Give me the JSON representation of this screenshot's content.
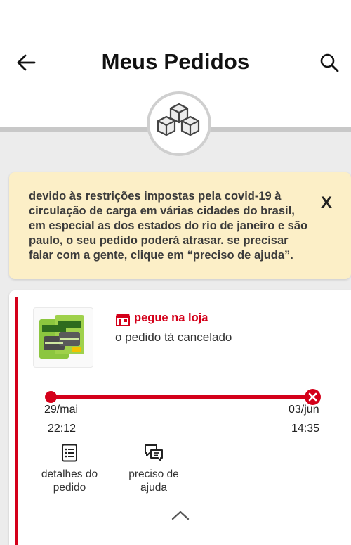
{
  "header": {
    "title": "Meus Pedidos"
  },
  "notice": {
    "text": "devido às restrições impostas pela covid-19 à circulação de carga em várias cidades do brasil, em especial as dos estados do rio de janeiro e são paulo, o seu pedido poderá atrasar. se precisar falar com a gente, clique em “preciso de ajuda”.",
    "close_label": "X"
  },
  "order": {
    "delivery_type": "pegue na loja",
    "status": "o pedido tá cancelado",
    "timeline": {
      "start_date": "29/mai",
      "start_time": "22:12",
      "end_date": "03/jun",
      "end_time": "14:35"
    },
    "actions": [
      {
        "label": "detalhes do pedido",
        "icon": "list-document-icon"
      },
      {
        "label": "preciso de ajuda",
        "icon": "chat-bubbles-icon"
      }
    ]
  },
  "colors": {
    "accent": "#d4001a",
    "notice_bg": "#fcefc7",
    "page_bg": "#ececec"
  },
  "icons": {
    "back": "arrow-left-icon",
    "search": "search-icon",
    "header_badge": "boxes-icon",
    "store": "store-icon",
    "cancel": "cancel-circle-icon",
    "collapse": "chevron-up-icon"
  }
}
